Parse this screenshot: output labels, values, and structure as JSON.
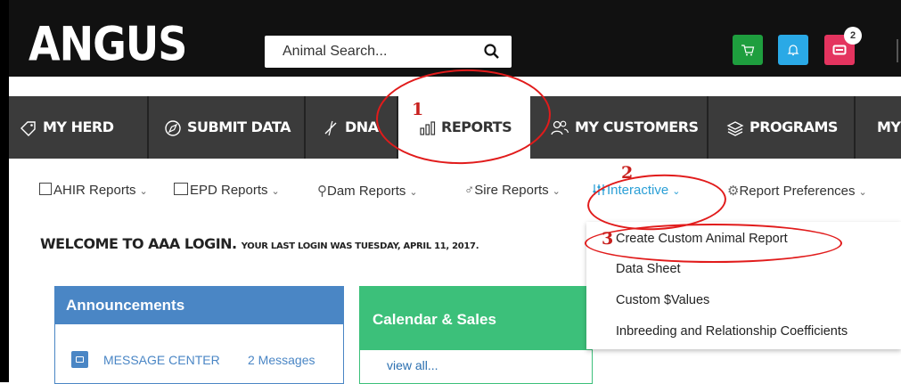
{
  "brand": {
    "logo": "ANGUS"
  },
  "search": {
    "placeholder": "Animal Search..."
  },
  "header": {
    "mail_badge": "2"
  },
  "nav": {
    "tabs": [
      {
        "label": "MY HERD",
        "icon": "tag-icon"
      },
      {
        "label": "SUBMIT DATA",
        "icon": "compass-icon"
      },
      {
        "label": "DNA",
        "icon": "dna-icon"
      },
      {
        "label": "REPORTS",
        "icon": "bar-chart-icon",
        "active": true
      },
      {
        "label": "MY CUSTOMERS",
        "icon": "users-icon"
      },
      {
        "label": "PROGRAMS",
        "icon": "layers-icon"
      },
      {
        "label": "MY",
        "icon": ""
      }
    ]
  },
  "subnav": {
    "items": [
      {
        "label": "AHIR Reports"
      },
      {
        "label": "EPD Reports"
      },
      {
        "label": "Dam Reports"
      },
      {
        "label": "Sire Reports"
      },
      {
        "label": "Interactive",
        "active": true
      },
      {
        "label": "Report Preferences"
      }
    ]
  },
  "welcome": {
    "heading": "WELCOME TO AAA LOGIN.",
    "last_login": "YOUR LAST LOGIN WAS TUESDAY, APRIL 11, 2017."
  },
  "announcements": {
    "title": "Announcements",
    "message_center": "MESSAGE CENTER",
    "message_count": "2 Messages"
  },
  "calendar": {
    "title": "Calendar & Sales",
    "view_all": "view all..."
  },
  "dropdown": {
    "items": [
      "Create Custom Animal Report",
      "Data Sheet",
      "Custom $Values",
      "Inbreeding and Relationship Coefficients"
    ]
  },
  "annotations": {
    "step1": "1",
    "step2": "2",
    "step3": "3"
  },
  "colors": {
    "nav_bg": "#3b3b3b",
    "accent_blue": "#2a9fd6",
    "announcement_blue": "#4a86c5",
    "calendar_green": "#3cc07a",
    "annotation_red": "#e11b1b"
  }
}
